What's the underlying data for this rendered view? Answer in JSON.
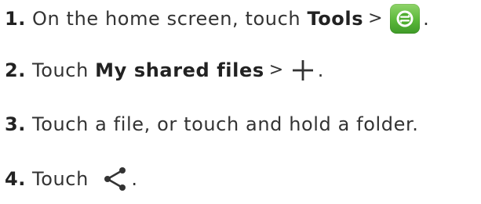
{
  "steps": [
    {
      "number": "1.",
      "text_before": "On the home screen, touch",
      "bold": "Tools",
      "separator": ">",
      "icon": "tools-app-icon",
      "end": "."
    },
    {
      "number": "2.",
      "text_before": "Touch",
      "bold": "My shared files",
      "separator": ">",
      "icon": "plus-icon",
      "end": "."
    },
    {
      "number": "3.",
      "text": "Touch a file, or touch and hold a folder."
    },
    {
      "number": "4.",
      "text_before": "Touch",
      "icon": "share-icon",
      "end": "."
    }
  ],
  "colors": {
    "text": "#333333",
    "icon_green": "#5bb83a"
  }
}
